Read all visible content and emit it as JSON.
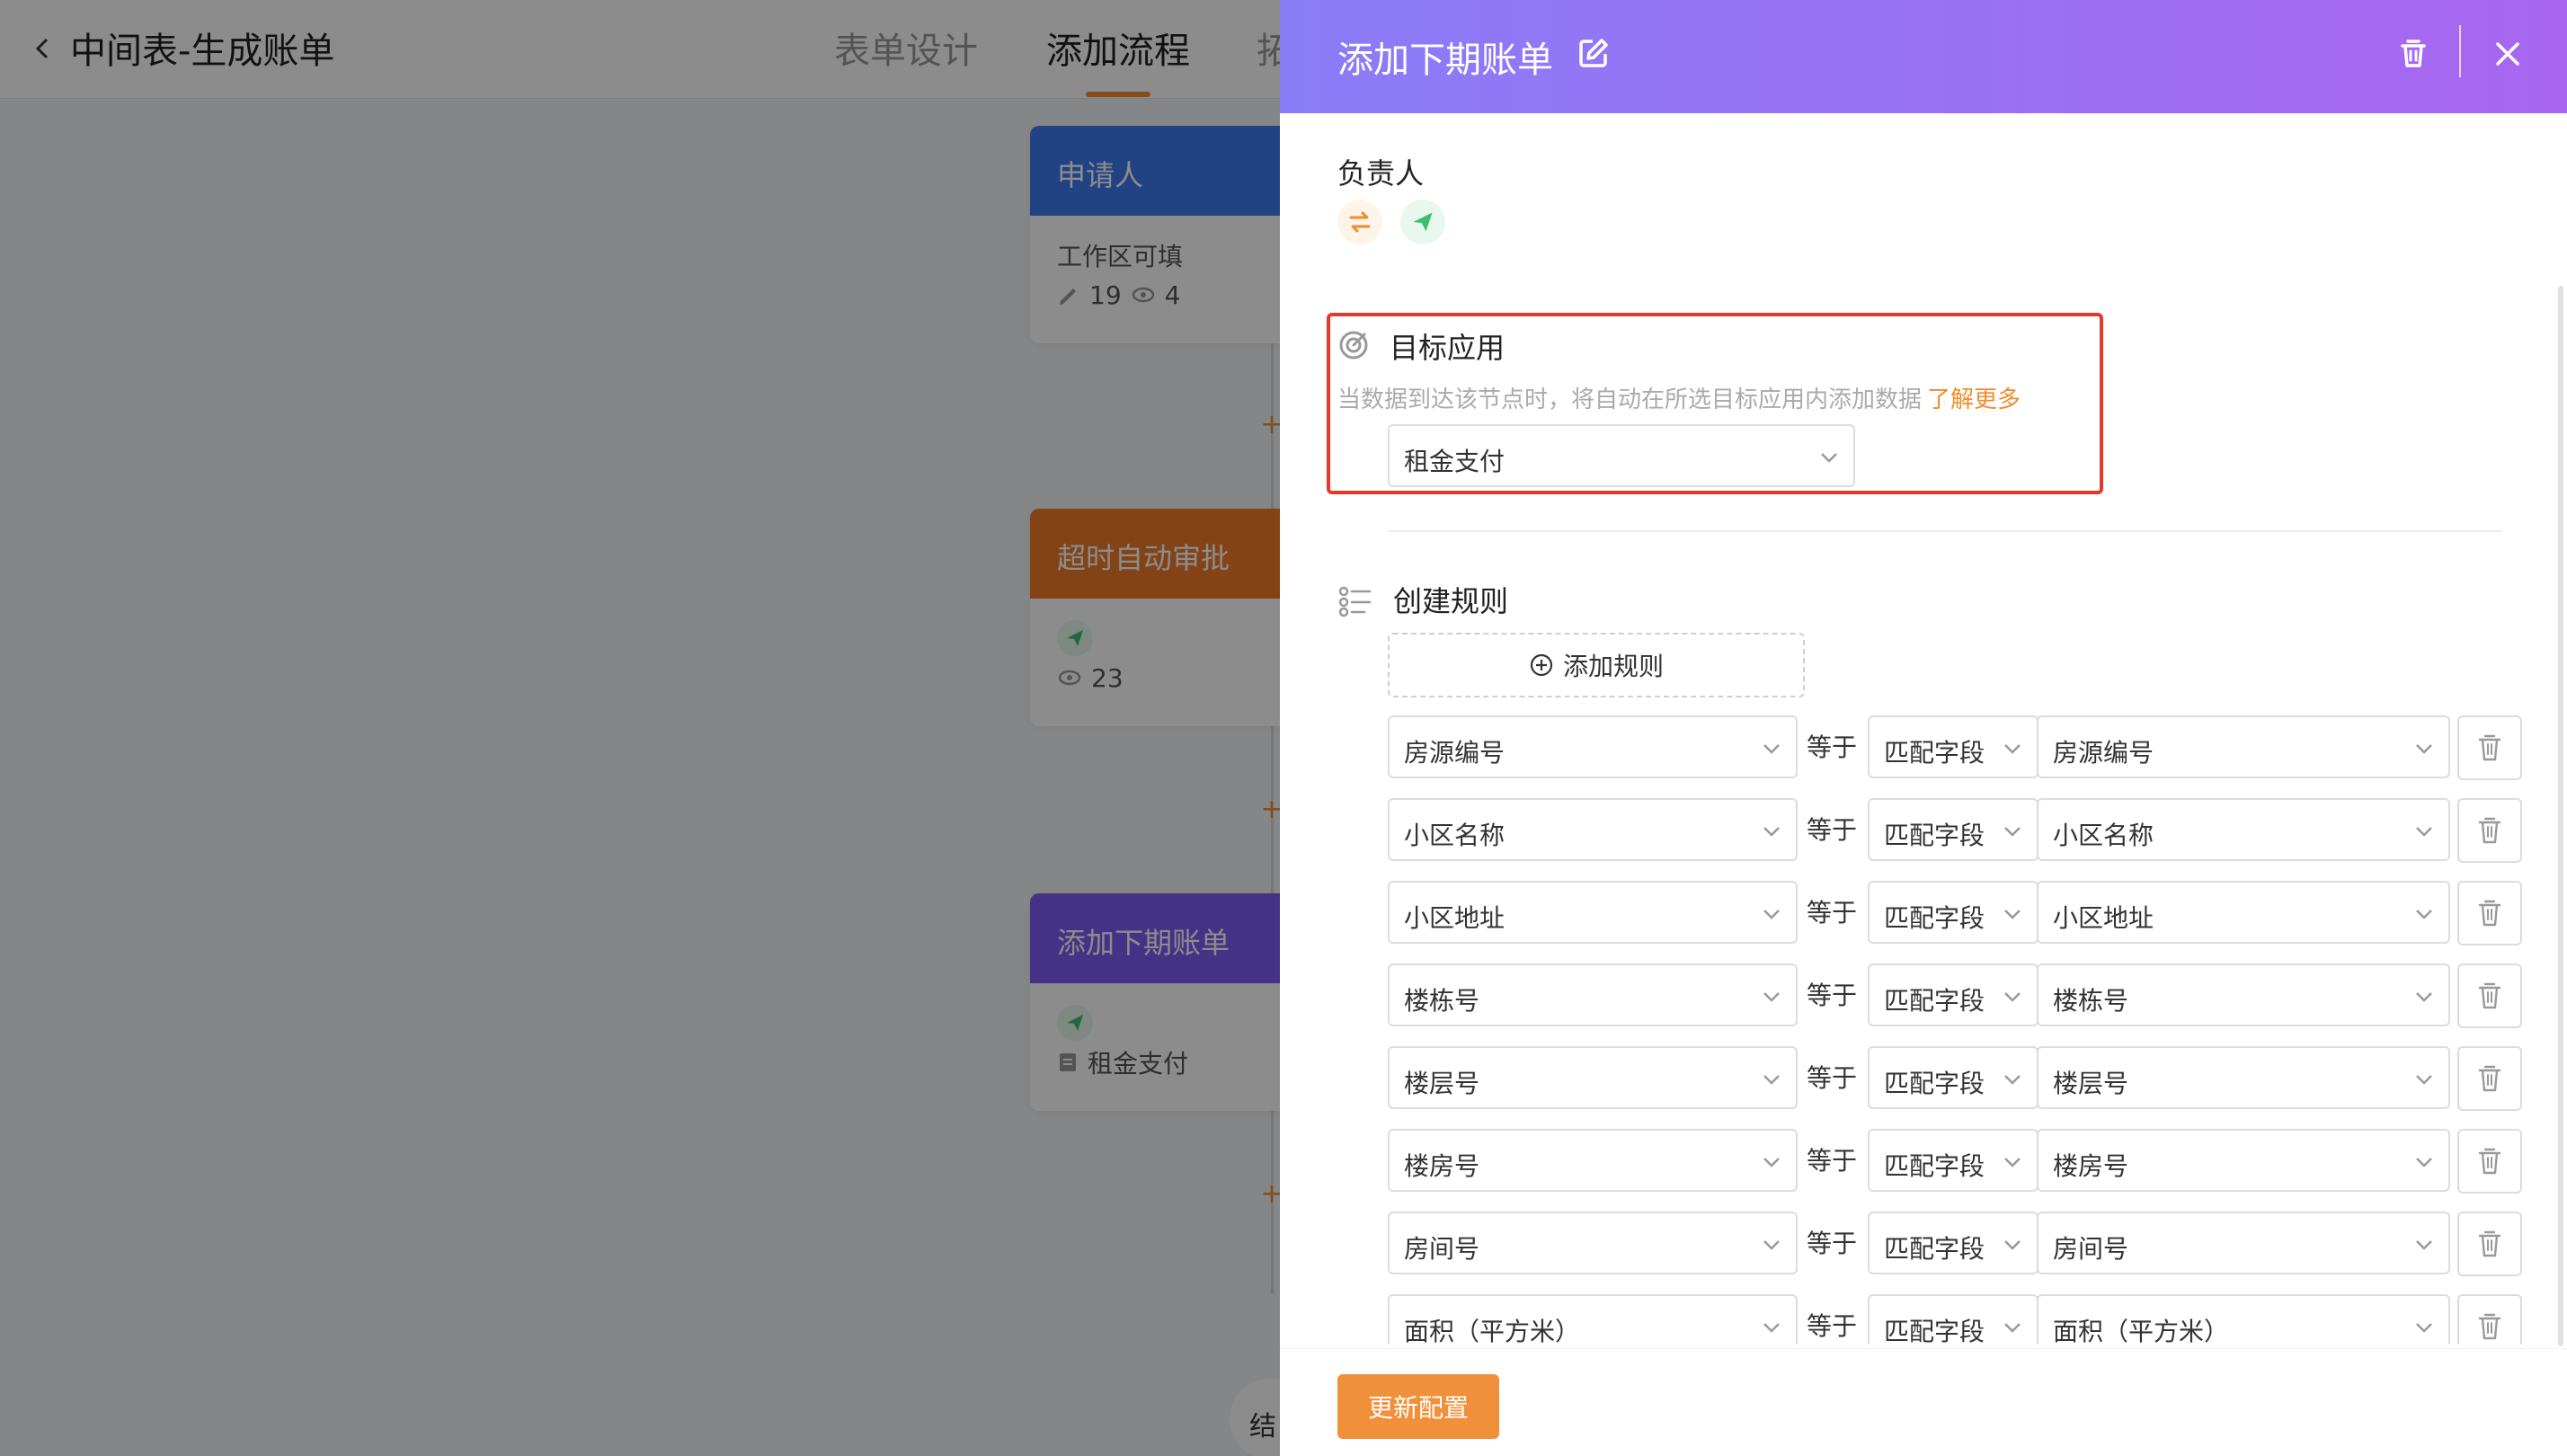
{
  "topbar": {
    "title": "中间表-生成账单",
    "tabs": [
      "表单设计",
      "添加流程",
      "拓"
    ]
  },
  "flow": {
    "nodes": [
      {
        "title": "申请人",
        "subtitle": "工作区可填",
        "edit_count": "19",
        "view_count": "4"
      },
      {
        "title": "超时自动审批",
        "view_count": "23"
      },
      {
        "title": "添加下期账单",
        "app_label": "租金支付"
      }
    ],
    "end_label": "结"
  },
  "drawer": {
    "title": "添加下期账单",
    "owner_label": "负责人",
    "target": {
      "label": "目标应用",
      "description": "当数据到达该节点时，将自动在所选目标应用内添加数据",
      "link_text": "了解更多",
      "selected_app": "租金支付"
    },
    "rules_label": "创建规则",
    "add_rule_label": "添加规则",
    "rules": [
      {
        "field": "房源编号",
        "op": "等于",
        "mode": "匹配字段",
        "target": "房源编号"
      },
      {
        "field": "小区名称",
        "op": "等于",
        "mode": "匹配字段",
        "target": "小区名称"
      },
      {
        "field": "小区地址",
        "op": "等于",
        "mode": "匹配字段",
        "target": "小区地址"
      },
      {
        "field": "楼栋号",
        "op": "等于",
        "mode": "匹配字段",
        "target": "楼栋号"
      },
      {
        "field": "楼层号",
        "op": "等于",
        "mode": "匹配字段",
        "target": "楼层号"
      },
      {
        "field": "楼房号",
        "op": "等于",
        "mode": "匹配字段",
        "target": "楼房号"
      },
      {
        "field": "房间号",
        "op": "等于",
        "mode": "匹配字段",
        "target": "房间号"
      },
      {
        "field": "面积（平方米）",
        "op": "等于",
        "mode": "匹配字段",
        "target": "面积（平方米）"
      }
    ],
    "update_button": "更新配置"
  },
  "colors": {
    "accent": "#f08c2e",
    "header_gradient_start": "#8a7cf7",
    "header_gradient_end": "#a866f0",
    "highlight_border": "#e23a2a"
  }
}
